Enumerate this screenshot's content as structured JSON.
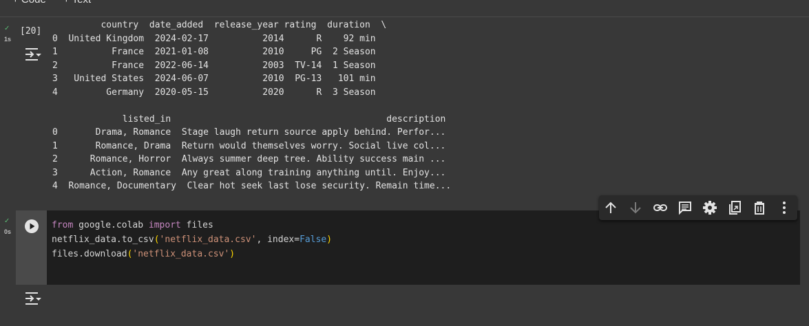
{
  "toolbar": {
    "code_label": "+ Code",
    "text_label": "+ Text"
  },
  "cell1": {
    "exec_count": "[20]",
    "status_check": "✓",
    "time": "1s",
    "output_lines": [
      "         country  date_added  release_year rating  duration  \\",
      "0  United Kingdom  2024-02-17          2014      R    92 min",
      "1          France  2021-01-08          2010     PG  2 Season",
      "2          France  2022-06-14          2003  TV-14  1 Season",
      "3   United States  2024-06-07          2010  PG-13   101 min",
      "4         Germany  2020-05-15          2020      R  3 Season",
      "",
      "             listed_in                                        description",
      "0       Drama, Romance  Stage laugh return source apply behind. Perfor...",
      "1       Romance, Drama  Return would themselves worry. Social live col...",
      "2      Romance, Horror  Always summer deep tree. Ability success main ...",
      "3      Action, Romance  Any great along training anything until. Enjoy...",
      "4  Romance, Documentary  Clear hot seek last lose security. Remain time..."
    ]
  },
  "cell2": {
    "status_check": "✓",
    "time": "0s",
    "code": {
      "l1_kw1": "from",
      "l1_mid": " google.colab ",
      "l1_kw2": "import",
      "l1_end": " files",
      "l2_a": "netflix_data.to_csv",
      "l2_po": "(",
      "l2_str": "'netflix_data.csv'",
      "l2_b": ", index=",
      "l2_false": "False",
      "l2_pc": ")",
      "l3_a": "files.download",
      "l3_po": "(",
      "l3_str": "'netflix_data.csv'",
      "l3_pc": ")"
    }
  },
  "cell_actions": [
    "move-up-icon",
    "move-down-icon",
    "link-icon",
    "comment-icon",
    "settings-icon",
    "mirror-cell-icon",
    "delete-icon",
    "more-vert-icon"
  ],
  "colors": {
    "background": "#383838",
    "code_bg": "#1e1e1e",
    "success_green": "#5bb974",
    "keyword": "#c586c0",
    "string": "#ce9178",
    "constant": "#569cd6"
  }
}
